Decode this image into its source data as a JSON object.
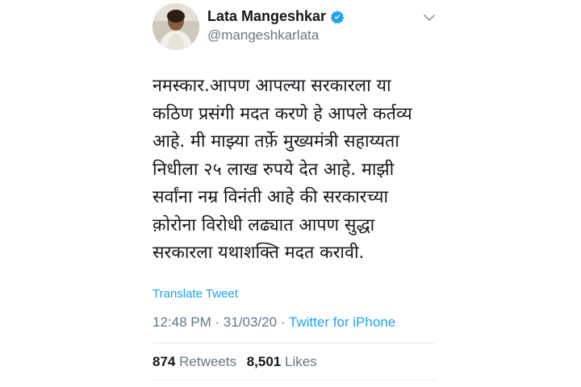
{
  "author": {
    "display_name": "Lata Mangeshkar",
    "handle": "@mangeshkarlata",
    "verified_icon": "verified-badge-icon",
    "menu_icon": "chevron-down-icon"
  },
  "tweet": {
    "lines": [
      "नमस्कार.आपण आपल्या सरकारला या",
      "कठिण प्रसंगी मदत करणे हे आपले कर्तव्य",
      "आहे. मी माझ्या तर्फ़े मुख्यमंत्री सहाय्यता",
      "निधीला २५ लाख रुपये देत आहे. माझी",
      "सर्वांना नम्र विनंती आहे की सरकारच्या",
      "क़ोरोना विरोधी लढ्यात आपण सुद्धा",
      "सरकारला यथाशक्ति मदत करावी."
    ],
    "translate_label": "Translate Tweet",
    "time": "12:48 PM",
    "date": "31/03/20",
    "separator": "·",
    "source": "Twitter for iPhone"
  },
  "stats": {
    "retweets_count": "874",
    "retweets_label": "Retweets",
    "likes_count": "8,501",
    "likes_label": "Likes"
  },
  "colors": {
    "link": "#1da1f2",
    "secondary_text": "#657786",
    "primary_text": "#14171a",
    "divider": "#e6ecf0"
  }
}
